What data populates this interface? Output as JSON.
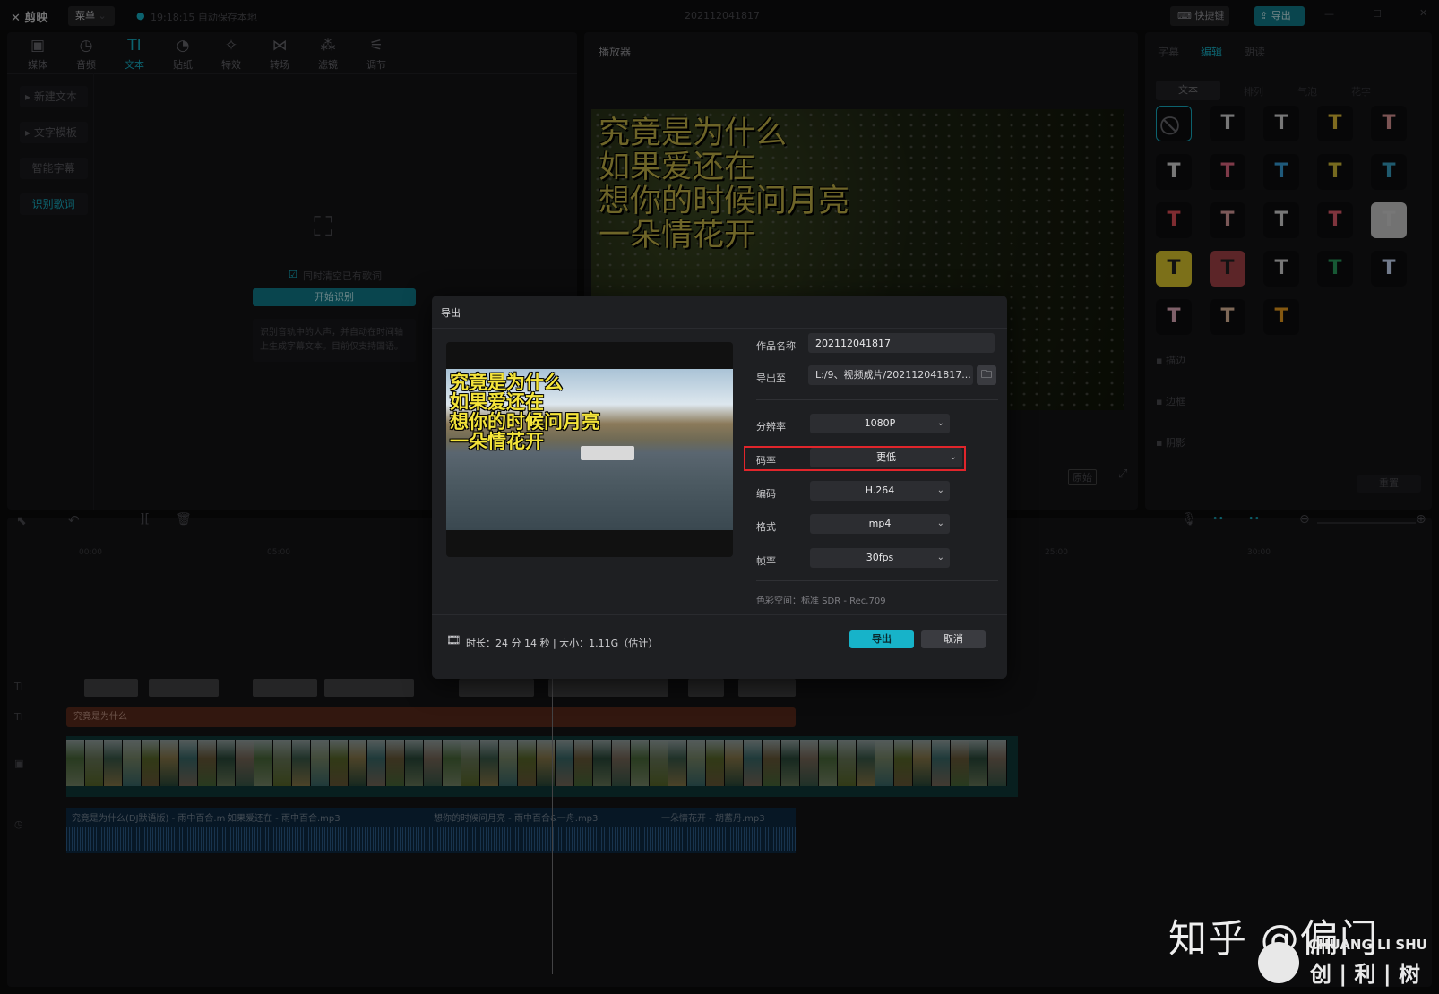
{
  "titlebar": {
    "app_name": "剪映",
    "menu_label": "菜单",
    "autosave": "19:18:15 自动保存本地",
    "project_title": "202112041817",
    "shortcut_label": "快捷键",
    "export_label": "导出"
  },
  "toolbar": {
    "items": [
      {
        "label": "媒体",
        "icon": "media-icon"
      },
      {
        "label": "音频",
        "icon": "audio-icon"
      },
      {
        "label": "文本",
        "icon": "text-icon"
      },
      {
        "label": "贴纸",
        "icon": "sticker-icon"
      },
      {
        "label": "特效",
        "icon": "effects-icon"
      },
      {
        "label": "转场",
        "icon": "transition-icon"
      },
      {
        "label": "滤镜",
        "icon": "filter-icon"
      },
      {
        "label": "调节",
        "icon": "adjust-icon"
      }
    ]
  },
  "left_nav": {
    "items": [
      "新建文本",
      "文字模板",
      "智能字幕",
      "识别歌词"
    ]
  },
  "recognize": {
    "checkbox_label": "同时清空已有歌词",
    "button_label": "开始识别",
    "help": "识别音轨中的人声，并自动在时间轴上生成字幕文本。目前仅支持国语。"
  },
  "player": {
    "title": "播放器",
    "lines": [
      "究竟是为什么",
      "如果爱还在",
      "想你的时候问月亮",
      "一朵情花开"
    ],
    "ratio_label": "原始"
  },
  "right_panel": {
    "tabs": [
      "字幕",
      "编辑",
      "朗读"
    ],
    "subtabs": [
      "文本",
      "排列",
      "气泡",
      "花字"
    ],
    "options": [
      "描边",
      "边框",
      "阴影"
    ],
    "reset_label": "重置"
  },
  "timeline": {
    "ruler": [
      "00:00",
      "05:00",
      "25:00",
      "30:00"
    ],
    "text_clip": "究竟是为什么",
    "audio_clips": [
      "究竟是为什么(DJ默语版) - 雨中百合.m",
      "如果爱还在 - 雨中百合.mp3",
      "想你的时候问月亮 - 雨中百合&一舟.mp3",
      "一朵情花开 - 胡蓄丹.mp3"
    ]
  },
  "dialog": {
    "title": "导出",
    "preview_lines": [
      "究竟是为什么",
      "如果爱还在",
      "想你的时候问月亮",
      "一朵情花开"
    ],
    "name_label": "作品名称",
    "name_value": "202112041817",
    "path_label": "导出至",
    "path_value": "L:/9、视频成片/202112041817...",
    "fields": [
      {
        "label": "分辨率",
        "value": "1080P"
      },
      {
        "label": "码率",
        "value": "更低"
      },
      {
        "label": "编码",
        "value": "H.264"
      },
      {
        "label": "格式",
        "value": "mp4"
      },
      {
        "label": "帧率",
        "value": "30fps"
      }
    ],
    "color_space": "色彩空间：标准 SDR - Rec.709",
    "info": "时长：24 分 14 秒 | 大小：1.11G（估计）",
    "export_label": "导出",
    "cancel_label": "取消"
  },
  "watermark": {
    "zhihu": "知乎 @偏门",
    "brand_en": "CHUANG LI SHU",
    "brand_cn": "创 | 利 | 树"
  },
  "colors": {
    "accent": "#17b3c9",
    "highlight": "#e1252b"
  }
}
